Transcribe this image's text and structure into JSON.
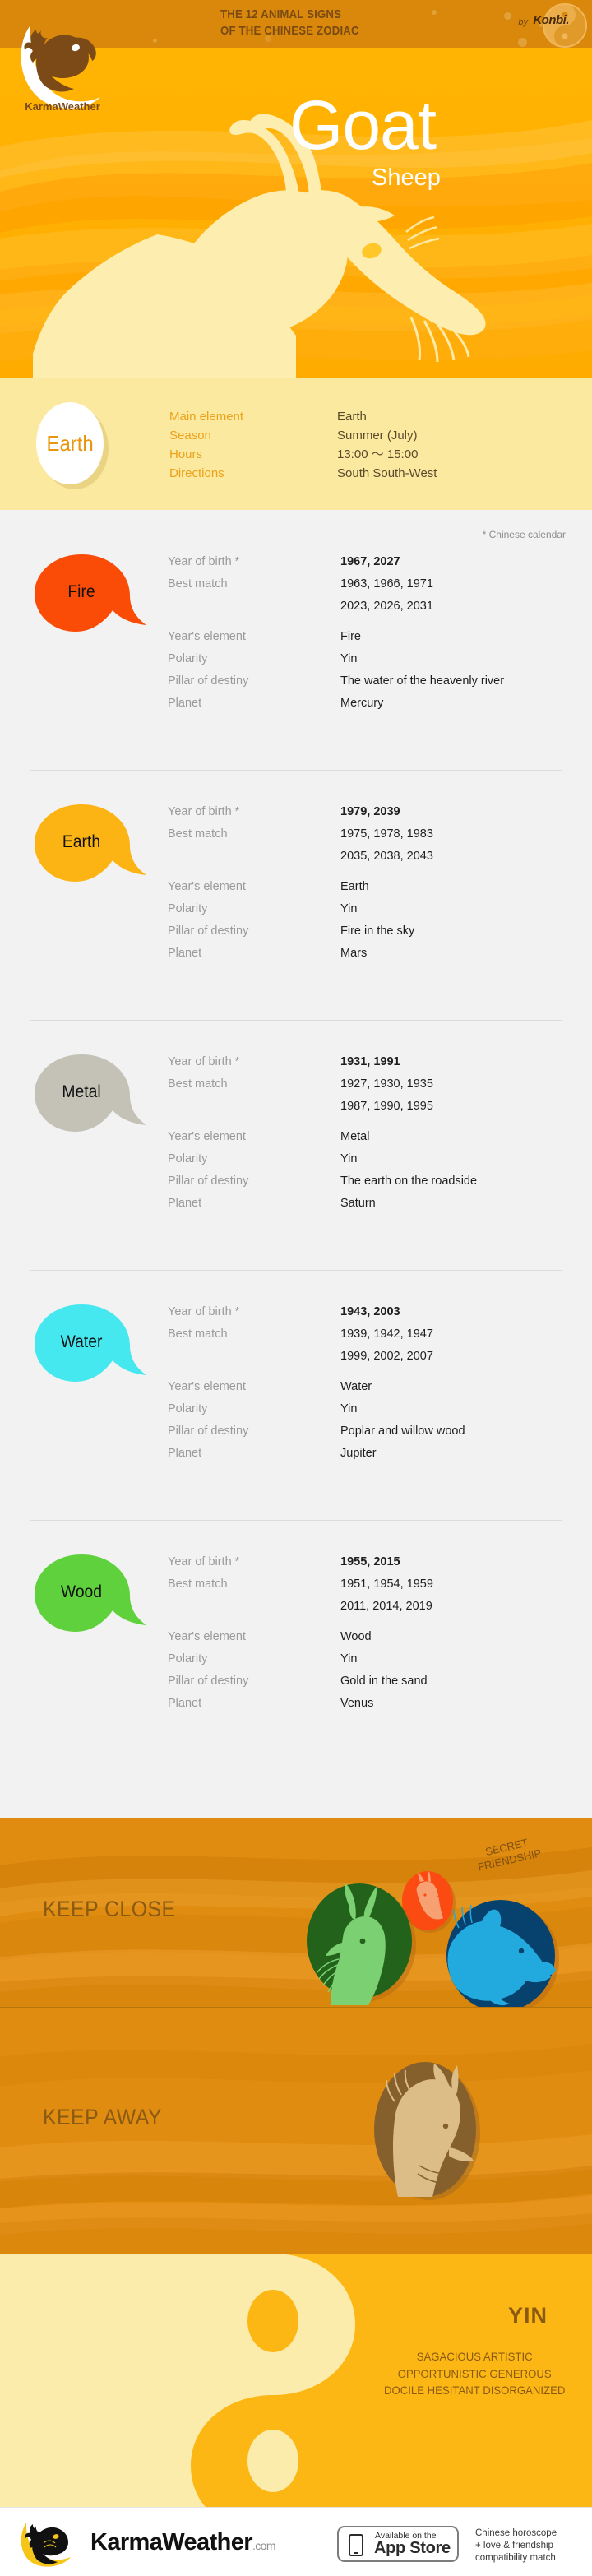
{
  "header": {
    "title_line1": "THE 12 ANIMAL SIGNS",
    "title_line2": "OF THE CHINESE ZODIAC",
    "by_label": "by",
    "brand": "Konbi.",
    "logo_text": "KarmaWeather®"
  },
  "hero": {
    "title": "Goat",
    "subtitle": "Sheep",
    "animal_icon": "goat-silhouette"
  },
  "summary": {
    "badge": "Earth",
    "rows": [
      {
        "key": "Main element",
        "value": "Earth"
      },
      {
        "key": "Season",
        "value": "Summer (July)"
      },
      {
        "key": "Hours",
        "value": "13:00 ～ 15:00"
      },
      {
        "key": "Directions",
        "value": "South South-West"
      }
    ]
  },
  "table": {
    "calendar_note": "* Chinese calendar",
    "labels": {
      "year_of_birth": "Year of birth *",
      "best_match": "Best match",
      "years_element": "Year's element",
      "polarity": "Polarity",
      "pillar": "Pillar of destiny",
      "planet": "Planet"
    },
    "blocks": [
      {
        "element": "Fire",
        "color": "#fa4b07",
        "year_of_birth": "1967, 2027",
        "best_match_1": "1963, 1966, 1971",
        "best_match_2": "2023, 2026, 2031",
        "years_element": "Fire",
        "polarity": "Yin",
        "pillar": "The water of the heavenly river",
        "planet": "Mercury"
      },
      {
        "element": "Earth",
        "color": "#fcb415",
        "year_of_birth": "1979, 2039",
        "best_match_1": "1975, 1978, 1983",
        "best_match_2": "2035, 2038, 2043",
        "years_element": "Earth",
        "polarity": "Yin",
        "pillar": "Fire in the sky",
        "planet": "Mars"
      },
      {
        "element": "Metal",
        "color": "#c4c2b6",
        "year_of_birth": "1931, 1991",
        "best_match_1": "1927, 1930, 1935",
        "best_match_2": "1987, 1990, 1995",
        "years_element": "Metal",
        "polarity": "Yin",
        "pillar": "The earth on the roadside",
        "planet": "Saturn"
      },
      {
        "element": "Water",
        "color": "#45e8ee",
        "year_of_birth": "1943, 2003",
        "best_match_1": "1939, 1942, 1947",
        "best_match_2": "1999, 2002, 2007",
        "years_element": "Water",
        "polarity": "Yin",
        "pillar": "Poplar and willow wood",
        "planet": "Jupiter"
      },
      {
        "element": "Wood",
        "color": "#5ed13c",
        "year_of_birth": "1955, 2015",
        "best_match_1": "1951, 1954, 1959",
        "best_match_2": "2011, 2014, 2019",
        "years_element": "Wood",
        "polarity": "Yin",
        "pillar": "Gold in the sand",
        "planet": "Venus"
      }
    ]
  },
  "keep_close": {
    "label": "KEEP CLOSE",
    "secret_label": "SECRET\nFRIENDSHIP",
    "animals": [
      {
        "name": "Rabbit",
        "icon": "rabbit-icon",
        "circle_color": "#23621a",
        "figure_color": "#7bd172"
      },
      {
        "name": "Pig",
        "icon": "pig-icon",
        "circle_color": "#07426e",
        "figure_color": "#22a9de"
      },
      {
        "name": "Horse",
        "icon": "horse-icon",
        "circle_color": "#fb4a12",
        "figure_color": "#f7a173"
      }
    ]
  },
  "keep_away": {
    "label": "KEEP AWAY",
    "animals": [
      {
        "name": "Ox",
        "icon": "ox-icon",
        "circle_color": "#86602c",
        "figure_color": "#dcbc87"
      }
    ]
  },
  "yin": {
    "title": "YIN",
    "traits": "SAGACIOUS\nARTISTIC\nOPPORTUNISTIC\nGENEROUS\nDOCILE\nHESITANT\nDISORGANIZED",
    "symbol": "yin-yang"
  },
  "footer": {
    "brand": "KarmaWeather",
    "brand_suffix": ".com",
    "appstore_small": "Available on the",
    "appstore_big": "App Store",
    "note": "Chinese horoscope\n+ love & friendship\ncompatibility match"
  },
  "colors": {
    "top_bar": "#d9880b",
    "hero": "#ffab00",
    "summary_bg": "#fbecab",
    "table_bg": "#f2f2f2",
    "band_bg": "#e08c10",
    "yin_bg": "#fbecab",
    "accent_brown": "#8a5a12"
  }
}
